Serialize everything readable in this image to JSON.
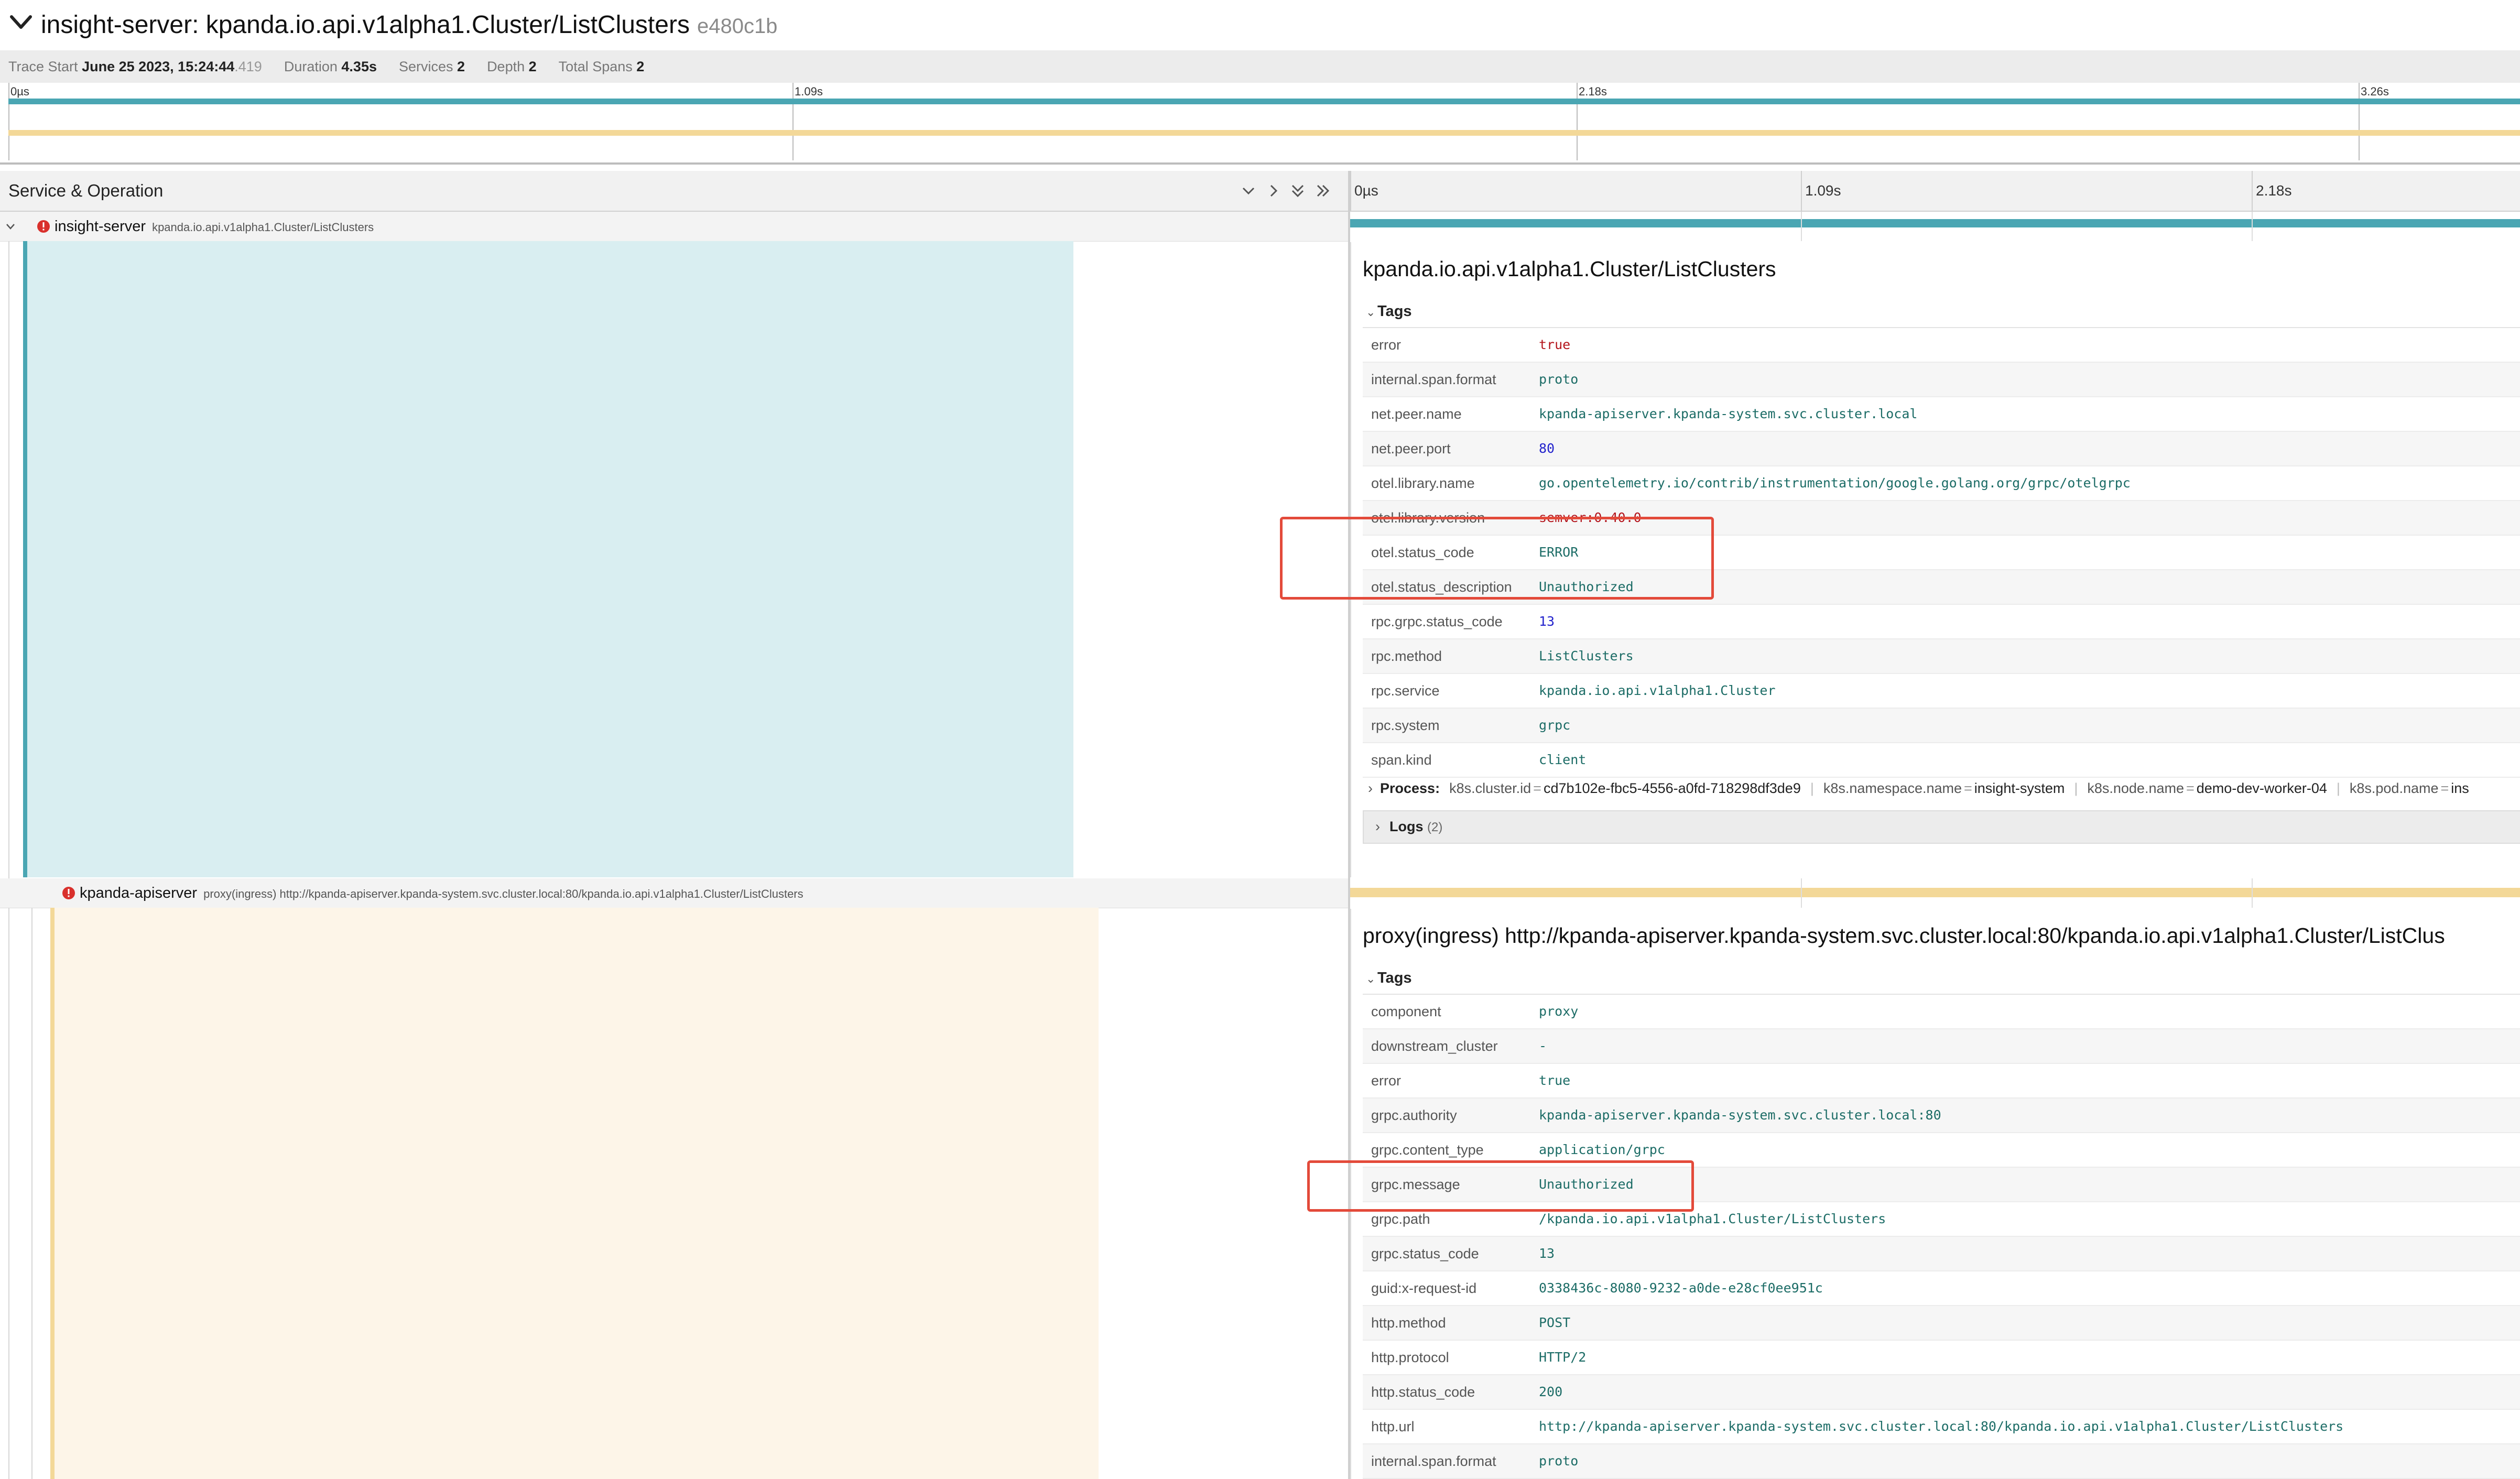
{
  "header": {
    "title": "insight-server: kpanda.io.api.v1alpha1.Cluster/ListClusters",
    "trace_id": "e480c1b"
  },
  "meta": {
    "trace_start_label": "Trace Start",
    "trace_start_value": "June 25 2023, 15:24:44",
    "trace_start_ms": ".419",
    "duration_label": "Duration",
    "duration_value": "4.35s",
    "services_label": "Services",
    "services_value": "2",
    "depth_label": "Depth",
    "depth_value": "2",
    "total_spans_label": "Total Spans",
    "total_spans_value": "2"
  },
  "minimap": {
    "ticks": [
      "0µs",
      "1.09s",
      "2.18s",
      "3.26s"
    ]
  },
  "columns": {
    "service_operation": "Service & Operation",
    "timeline_ticks": [
      "0µs",
      "1.09s",
      "2.18s"
    ]
  },
  "colors": {
    "span1": "#4aa6b3",
    "span1_fill": "#d9eef1",
    "span2": "#f3d898",
    "span2_fill": "#fdf5e8",
    "error": "#d9302c",
    "highlight": "#e34a3a"
  },
  "spans": [
    {
      "service": "insight-server",
      "operation": "kpanda.io.api.v1alpha1.Cluster/ListClusters",
      "detail_title": "kpanda.io.api.v1alpha1.Cluster/ListClusters",
      "tags_label": "Tags",
      "tags": [
        {
          "key": "error",
          "value": "true"
        },
        {
          "key": "internal.span.format",
          "value": "proto"
        },
        {
          "key": "net.peer.name",
          "value": "kpanda-apiserver.kpanda-system.svc.cluster.local"
        },
        {
          "key": "net.peer.port",
          "value": "80"
        },
        {
          "key": "otel.library.name",
          "value": "go.opentelemetry.io/contrib/instrumentation/google.golang.org/grpc/otelgrpc"
        },
        {
          "key": "otel.library.version",
          "value": "semver:0.40.0"
        },
        {
          "key": "otel.status_code",
          "value": "ERROR"
        },
        {
          "key": "otel.status_description",
          "value": "Unauthorized"
        },
        {
          "key": "rpc.grpc.status_code",
          "value": "13"
        },
        {
          "key": "rpc.method",
          "value": "ListClusters"
        },
        {
          "key": "rpc.service",
          "value": "kpanda.io.api.v1alpha1.Cluster"
        },
        {
          "key": "rpc.system",
          "value": "grpc"
        },
        {
          "key": "span.kind",
          "value": "client"
        }
      ],
      "process": {
        "label": "Process:",
        "items": [
          {
            "key": "k8s.cluster.id",
            "value": "cd7b102e-fbc5-4556-a0fd-718298df3de9"
          },
          {
            "key": "k8s.namespace.name",
            "value": "insight-system"
          },
          {
            "key": "k8s.node.name",
            "value": "demo-dev-worker-04"
          },
          {
            "key": "k8s.pod.name",
            "value": "ins"
          }
        ]
      },
      "logs_label": "Logs",
      "logs_count": "(2)"
    },
    {
      "service": "kpanda-apiserver",
      "operation": "proxy(ingress) http://kpanda-apiserver.kpanda-system.svc.cluster.local:80/kpanda.io.api.v1alpha1.Cluster/ListClusters",
      "detail_title": "proxy(ingress) http://kpanda-apiserver.kpanda-system.svc.cluster.local:80/kpanda.io.api.v1alpha1.Cluster/ListClus",
      "tags_label": "Tags",
      "tags": [
        {
          "key": "component",
          "value": "proxy"
        },
        {
          "key": "downstream_cluster",
          "value": "-"
        },
        {
          "key": "error",
          "value": "true"
        },
        {
          "key": "grpc.authority",
          "value": "kpanda-apiserver.kpanda-system.svc.cluster.local:80"
        },
        {
          "key": "grpc.content_type",
          "value": "application/grpc"
        },
        {
          "key": "grpc.message",
          "value": "Unauthorized"
        },
        {
          "key": "grpc.path",
          "value": "/kpanda.io.api.v1alpha1.Cluster/ListClusters"
        },
        {
          "key": "grpc.status_code",
          "value": "13"
        },
        {
          "key": "guid:x-request-id",
          "value": "0338436c-8080-9232-a0de-e28cf0ee951c"
        },
        {
          "key": "http.method",
          "value": "POST"
        },
        {
          "key": "http.protocol",
          "value": "HTTP/2"
        },
        {
          "key": "http.status_code",
          "value": "200"
        },
        {
          "key": "http.url",
          "value": "http://kpanda-apiserver.kpanda-system.svc.cluster.local:80/kpanda.io.api.v1alpha1.Cluster/ListClusters"
        },
        {
          "key": "internal.span.format",
          "value": "proto"
        }
      ]
    }
  ]
}
